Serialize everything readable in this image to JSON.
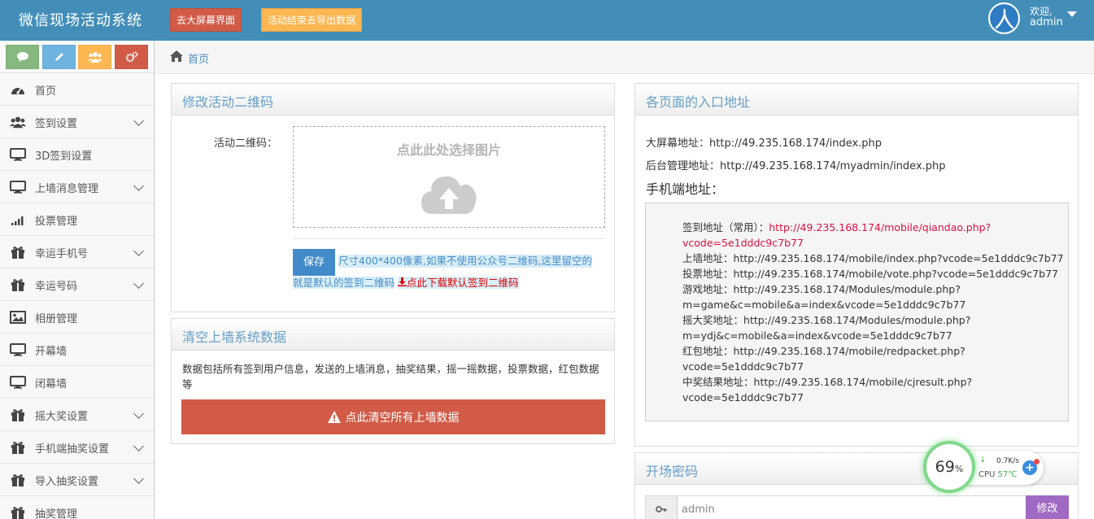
{
  "header": {
    "brand": "微信现场活动系统",
    "bigscreen_button": "去大屏幕界面",
    "export_button": "活动结束去导出数据",
    "greeting": "欢迎,",
    "username": "admin"
  },
  "colors": {
    "topbar": "#438eb9",
    "danger": "#d15b47",
    "warning": "#ffb752",
    "success": "#87b87f",
    "info": "#6fb3e0",
    "primary": "#428bca",
    "purple": "#a069c3",
    "link_red": "#dd1144"
  },
  "sidebar": {
    "shortcuts": [
      {
        "icon": "comments-icon"
      },
      {
        "icon": "pencil-icon"
      },
      {
        "icon": "users-icon"
      },
      {
        "icon": "cogs-icon"
      }
    ],
    "items": [
      {
        "label": "首页",
        "icon": "dashboard-icon",
        "has_children": false
      },
      {
        "label": "签到设置",
        "icon": "users-icon",
        "has_children": true
      },
      {
        "label": "3D签到设置",
        "icon": "desktop-icon",
        "has_children": false
      },
      {
        "label": "上墙消息管理",
        "icon": "desktop-icon",
        "has_children": true
      },
      {
        "label": "投票管理",
        "icon": "signal-icon",
        "has_children": false
      },
      {
        "label": "幸运手机号",
        "icon": "gift-icon",
        "has_children": true
      },
      {
        "label": "幸运号码",
        "icon": "gift-icon",
        "has_children": true
      },
      {
        "label": "相册管理",
        "icon": "picture-icon",
        "has_children": false
      },
      {
        "label": "开幕墙",
        "icon": "desktop-icon",
        "has_children": false
      },
      {
        "label": "闭幕墙",
        "icon": "desktop-icon",
        "has_children": false
      },
      {
        "label": "摇大奖设置",
        "icon": "gift-icon",
        "has_children": true
      },
      {
        "label": "手机端抽奖设置",
        "icon": "gift-icon",
        "has_children": true
      },
      {
        "label": "导入抽奖设置",
        "icon": "gift-icon",
        "has_children": true
      },
      {
        "label": "抽奖管理",
        "icon": "gift-icon",
        "has_children": false
      }
    ]
  },
  "breadcrumb": {
    "home": "首页"
  },
  "qrcode_panel": {
    "title": "修改活动二维码",
    "field_label": "活动二维码：",
    "upload_text": "点此此处选择图片",
    "save_button": "保存",
    "hint_part1": "尺寸400*400像素,如果不使用公众号二维码,这里留空的",
    "hint_part2": "就是默认的签到二维码",
    "download_link": "点此下载默认签到二维码"
  },
  "clear_panel": {
    "title": "清空上墙系统数据",
    "description": "数据包括所有签到用户信息，发送的上墙消息，抽奖结果，摇一摇数据，投票数据，红包数据等",
    "clear_button": "点此清空所有上墙数据"
  },
  "entry_panel": {
    "title": "各页面的入口地址",
    "bigscreen_label": "大屏幕地址：",
    "bigscreen_url": "http://49.235.168.174/index.php",
    "admin_label": "后台管理地址：",
    "admin_url": "http://49.235.168.174/myadmin/index.php",
    "mobile_title": "手机端地址：",
    "mobile_links": [
      {
        "label": "签到地址（常用）：",
        "url_a": "http://49.235.168.174/mobile/qiandao.php?",
        "url_b": "vcode=5e1dddc9c7b77"
      },
      {
        "label": "上墙地址：",
        "url_a": "http://49.235.168.174/mobile/index.php?vcode=5e1dddc9c7b77",
        "url_b": ""
      },
      {
        "label": "投票地址：",
        "url_a": "http://49.235.168.174/mobile/vote.php?vcode=5e1dddc9c7b77",
        "url_b": ""
      },
      {
        "label": "游戏地址：",
        "url_a": "http://49.235.168.174/Modules/module.php?",
        "url_b": "m=game&c=mobile&a=index&vcode=5e1dddc9c7b77"
      },
      {
        "label": "摇大奖地址：",
        "url_a": "http://49.235.168.174/Modules/module.php?",
        "url_b": "m=ydj&c=mobile&a=index&vcode=5e1dddc9c7b77"
      },
      {
        "label": "红包地址：",
        "url_a": "http://49.235.168.174/mobile/redpacket.php?",
        "url_b": "vcode=5e1dddc9c7b77"
      },
      {
        "label": "中奖结果地址：",
        "url_a": "http://49.235.168.174/mobile/cjresult.php?",
        "url_b": "vcode=5e1dddc9c7b77"
      }
    ]
  },
  "password_panel": {
    "title": "开场密码",
    "value": "admin",
    "modify_button": "修改"
  },
  "widget": {
    "cpu_usage_pct": "69",
    "pct_unit": "%",
    "net_speed": "0.7K/s",
    "cpu_label": "CPU",
    "cpu_temp": "57℃"
  }
}
